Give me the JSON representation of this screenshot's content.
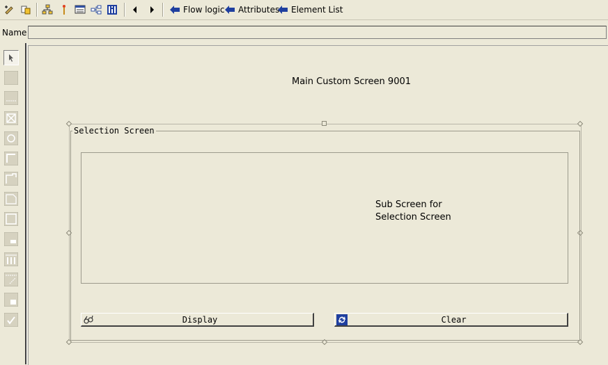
{
  "toolbar": {
    "icons": [
      "pencil-icon",
      "toggle-display-change-icon",
      "hierarchy-icon",
      "where-used-icon",
      "layout-icon",
      "navigate-icon",
      "info-icon",
      "back-arrow-icon",
      "forward-arrow-icon"
    ],
    "links": [
      {
        "label": "Flow logic",
        "icon": "blue-left-arrow-icon"
      },
      {
        "label": "Attributes",
        "icon": "blue-left-arrow-icon"
      },
      {
        "label": "Element List",
        "icon": "blue-left-arrow-icon"
      }
    ]
  },
  "name_field": {
    "label": "Name",
    "value": ""
  },
  "palette": {
    "items": [
      "pointer-tool-icon",
      "text-field-tool-icon",
      "input-field-tool-icon",
      "checkbox-tool-icon",
      "radio-button-tool-icon",
      "box-tool-icon",
      "subscreen-tool-icon",
      "table-control-tool-icon",
      "frame-tool-icon",
      "tabstrip-tool-icon",
      "table-wizard-tool-icon",
      "step-loop-tool-icon",
      "custom-control-tool-icon",
      "status-icon-tool-icon"
    ]
  },
  "canvas": {
    "title": "Main Custom Screen 9001",
    "group_box_title": "Selection Screen",
    "subscreen_label_line1": "Sub Screen for",
    "subscreen_label_line2": "Selection Screen",
    "buttons": [
      {
        "label": "Display",
        "icon": "glasses-icon"
      },
      {
        "label": "Clear",
        "icon": "refresh-icon"
      }
    ]
  },
  "colors": {
    "background": "#ece9d8",
    "link_arrow": "#1f3f9f"
  }
}
